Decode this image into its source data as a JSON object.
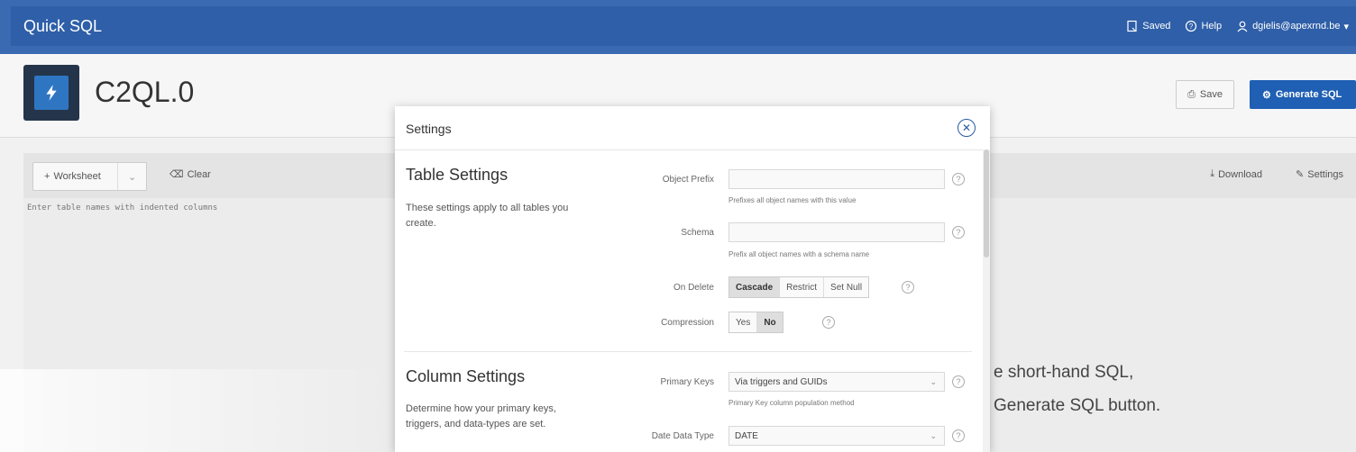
{
  "app": {
    "title": "Quick SQL",
    "nav": {
      "saved": "Saved",
      "help": "Help",
      "user": "dgielis@apexrnd.be"
    }
  },
  "header": {
    "title": "C2QL.0",
    "save_label": "Save",
    "generate_label": "Generate SQL"
  },
  "editor": {
    "worksheet_label": "Worksheet",
    "clear_label": "Clear",
    "placeholder": "Enter table names with indented columns"
  },
  "output": {
    "download_label": "Download",
    "settings_label": "Settings",
    "hint_line1": "e short-hand SQL,",
    "hint_line2": "Generate SQL button."
  },
  "modal": {
    "title": "Settings",
    "table_settings": {
      "title": "Table Settings",
      "desc": "These settings apply to all tables you create.",
      "object_prefix_label": "Object Prefix",
      "object_prefix_value": "",
      "object_prefix_note": "Prefixes all object names with this value",
      "schema_label": "Schema",
      "schema_value": "",
      "schema_note": "Prefix all object names with a schema name",
      "on_delete_label": "On Delete",
      "on_delete_options": [
        "Cascade",
        "Restrict",
        "Set Null"
      ],
      "on_delete_selected": "Cascade",
      "compression_label": "Compression",
      "compression_options": [
        "Yes",
        "No"
      ],
      "compression_selected": "No"
    },
    "column_settings": {
      "title": "Column Settings",
      "desc": "Determine how your primary keys, triggers, and data-types are set.",
      "primary_keys_label": "Primary Keys",
      "primary_keys_value": "Via triggers and GUIDs",
      "primary_keys_note": "Primary Key column population method",
      "date_type_label": "Date Data Type",
      "date_type_value": "DATE"
    }
  }
}
